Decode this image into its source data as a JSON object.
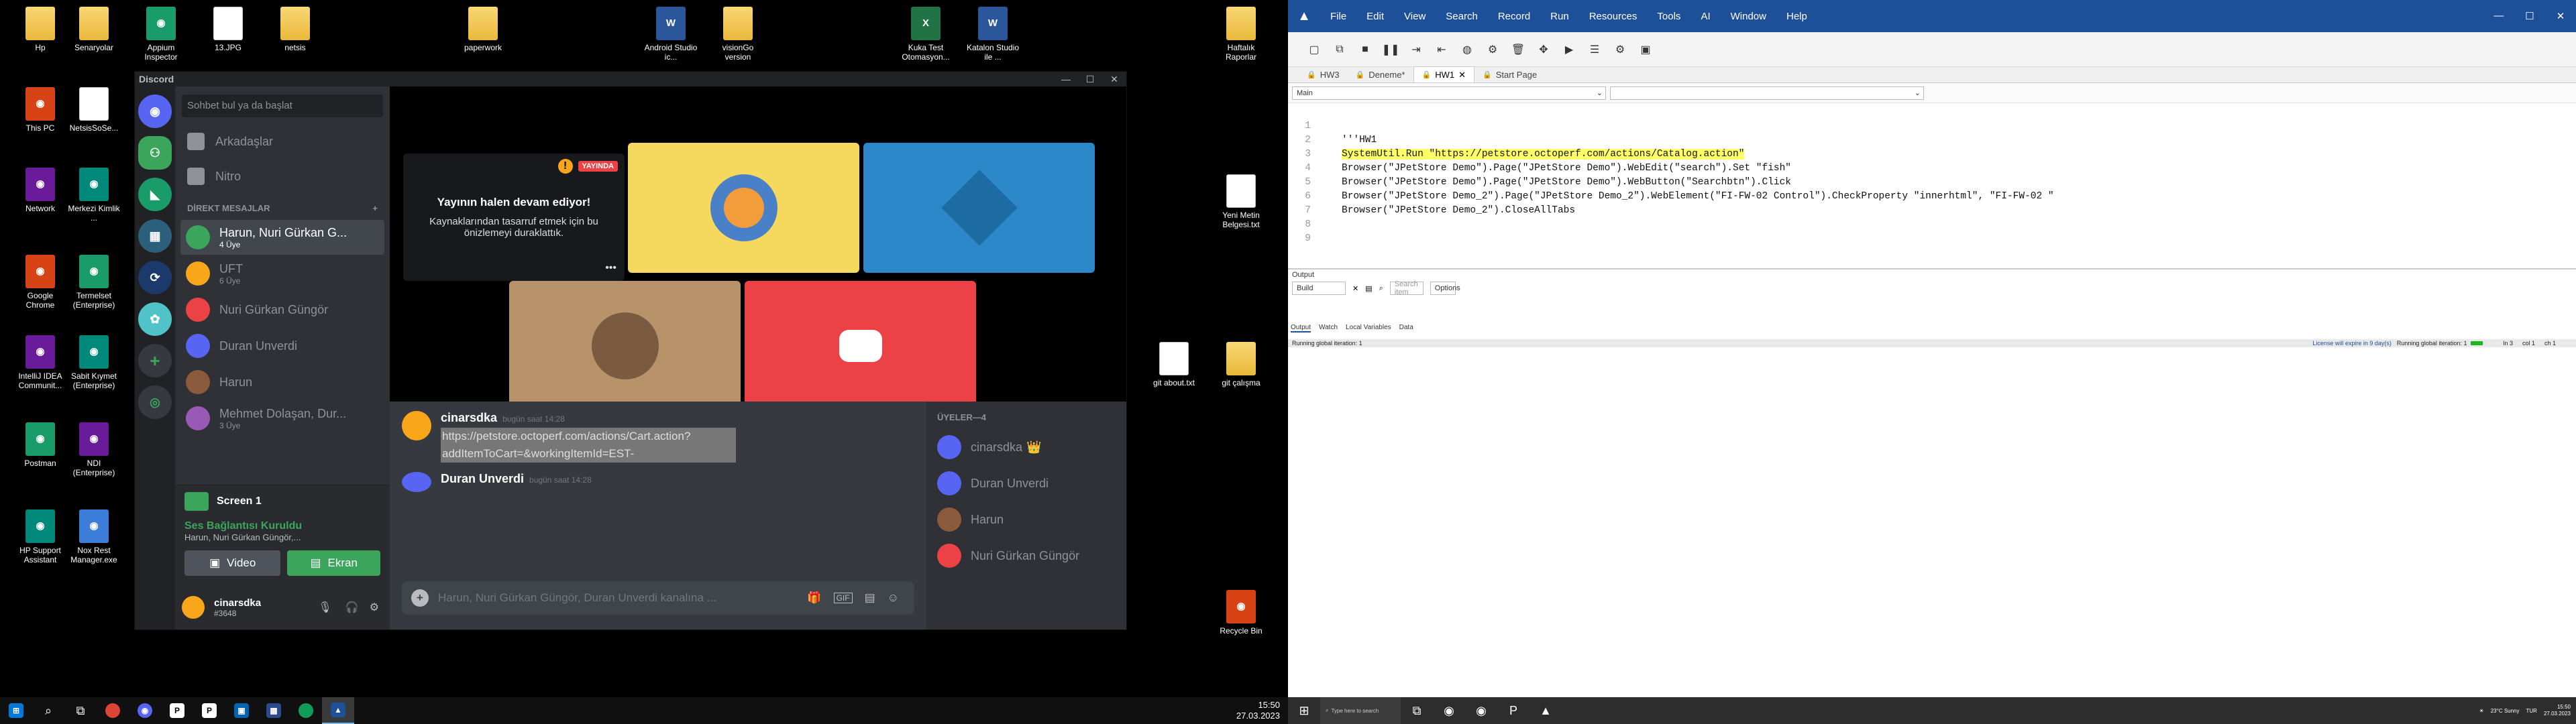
{
  "desktop_left": {
    "icons": [
      {
        "label": "Hp",
        "type": "folder"
      },
      {
        "label": "Senaryolar",
        "type": "folder"
      },
      {
        "label": "Appium Inspector",
        "type": "app"
      },
      {
        "label": "13.JPG",
        "type": "doc"
      },
      {
        "label": "netsis",
        "type": "folder"
      },
      {
        "label": "paperwork",
        "type": "folder"
      },
      {
        "label": "Android Studio ic...",
        "type": "word"
      },
      {
        "label": "visionGo version",
        "type": "folder"
      },
      {
        "label": "Kuka Test Otomasyon...",
        "type": "excel"
      },
      {
        "label": "Katalon Studio ile ...",
        "type": "word"
      },
      {
        "label": "Haftalık Raporlar",
        "type": "folder"
      },
      {
        "label": "This PC",
        "type": "app"
      },
      {
        "label": "NetsisSoSe...",
        "type": "doc"
      },
      {
        "label": "Network",
        "type": "app"
      },
      {
        "label": "Merkezi Kimlik ...",
        "type": "app"
      },
      {
        "label": "Yeni Metin Belgesi.txt",
        "type": "txt"
      },
      {
        "label": "Google Chrome",
        "type": "app"
      },
      {
        "label": "Termelset (Enterprise)",
        "type": "app"
      },
      {
        "label": "IntelliJ IDEA Communit...",
        "type": "app"
      },
      {
        "label": "Sabit Kıymet (Enterprise)",
        "type": "app"
      },
      {
        "label": "git about.txt",
        "type": "txt"
      },
      {
        "label": "git çalışma",
        "type": "folder"
      },
      {
        "label": "Postman",
        "type": "app"
      },
      {
        "label": "NDI (Enterprise)",
        "type": "app"
      },
      {
        "label": "HP Support Assistant",
        "type": "app"
      },
      {
        "label": "Nox Rest Manager.exe",
        "type": "app"
      },
      {
        "label": "Recycle Bin",
        "type": "app"
      }
    ]
  },
  "discord": {
    "window_title": "Discord",
    "search_placeholder": "Sohbet bul ya da başlat",
    "friends": "Arkadaşlar",
    "nitro": "Nitro",
    "dm_header": "DİREKT MESAJLAR",
    "dms": [
      {
        "name": "Harun, Nuri Gürkan G...",
        "sub": "4 Üye",
        "color": "#3ba55c",
        "active": true
      },
      {
        "name": "UFT",
        "sub": "6 Üye",
        "color": "#faa61a",
        "active": false
      },
      {
        "name": "Nuri Gürkan Güngör",
        "sub": "",
        "color": "#ed4245",
        "active": false
      },
      {
        "name": "Duran Unverdi",
        "sub": "",
        "color": "#5865f2",
        "active": false
      },
      {
        "name": "Harun",
        "sub": "",
        "color": "#8b5a3c",
        "active": false
      },
      {
        "name": "Mehmet Dolaşan, Dur...",
        "sub": "3 Üye",
        "color": "#9b59b6",
        "active": false
      }
    ],
    "screen_label": "Screen 1",
    "voice_status": "Ses Bağlantısı Kuruldu",
    "voice_sub": "Harun, Nuri Gürkan Güngör,...",
    "video_btn": "Video",
    "screen_btn": "Ekran",
    "username": "cinarsdka",
    "user_tag": "#3648",
    "live_badge": "YAYINDA",
    "stream_title": "Yayının halen devam ediyor!",
    "stream_sub": "Kaynaklarından tasarruf etmek için bu önizlemeyi duraklattık.",
    "chat": {
      "msg1_author": "cinarsdka",
      "msg1_time": "bugün saat 14:28",
      "msg1_text": "https://petstore.octoperf.com/actions/Cart.action?addItemToCart=&workingItemId=EST-",
      "msg2_author": "Duran Unverdi",
      "msg2_time": "bugün saat 14:28",
      "input_placeholder": "Harun, Nuri Gürkan Güngör, Duran Unverdi kanalına ..."
    },
    "members_header": "ÜYELER—4",
    "members": [
      {
        "name": "cinarsdka",
        "crown": "👑",
        "color": "#5865f2"
      },
      {
        "name": "Duran Unverdi",
        "crown": "",
        "color": "#5865f2"
      },
      {
        "name": "Harun",
        "crown": "",
        "color": "#8b5a3c"
      },
      {
        "name": "Nuri Gürkan Güngör",
        "crown": "",
        "color": "#ed4245"
      }
    ]
  },
  "taskbar_left": {
    "time": "15:50",
    "date": "27.03.2023"
  },
  "uft": {
    "menu": [
      "File",
      "Edit",
      "View",
      "Search",
      "Record",
      "Run",
      "Resources",
      "Tools",
      "AI",
      "Window",
      "Help"
    ],
    "tabs": [
      {
        "label": "HW3",
        "active": false
      },
      {
        "label": "Deneme*",
        "active": false
      },
      {
        "label": "HW1",
        "active": true
      },
      {
        "label": "Start Page",
        "active": false
      }
    ],
    "action_combo": "Main",
    "code_lines": [
      "",
      "'''HW1",
      "SystemUtil.Run \"https://petstore.octoperf.com/actions/Catalog.action\"",
      "Browser(\"JPetStore Demo\").Page(\"JPetStore Demo\").WebEdit(\"search\").Set \"fish\"",
      "Browser(\"JPetStore Demo\").Page(\"JPetStore Demo\").WebButton(\"Searchbtn\").Click",
      "Browser(\"JPetStore Demo_2\").Page(\"JPetStore Demo_2\").WebElement(\"FI-FW-02 Control\").CheckProperty \"innerhtml\", \"FI-FW-02 \"",
      "Browser(\"JPetStore Demo_2\").CloseAllTabs",
      "",
      ""
    ],
    "output_title": "Output",
    "output_combo": "Build",
    "output_search": "Search item",
    "output_options": "Options",
    "bottom_tabs": [
      "Output",
      "Watch",
      "Local Variables",
      "Data"
    ],
    "status_left": "Running global iteration: 1",
    "license": "License will expire in 9 day(s)",
    "status_right": "Running global iteration: 1",
    "ln": "ln 3",
    "col": "col 1",
    "ch": "ch 1"
  },
  "taskbar_right": {
    "search_placeholder": "Type here to search",
    "weather": "23°C Sunny",
    "lang": "TUR",
    "time": "15:50",
    "date": "27.03.2023"
  }
}
